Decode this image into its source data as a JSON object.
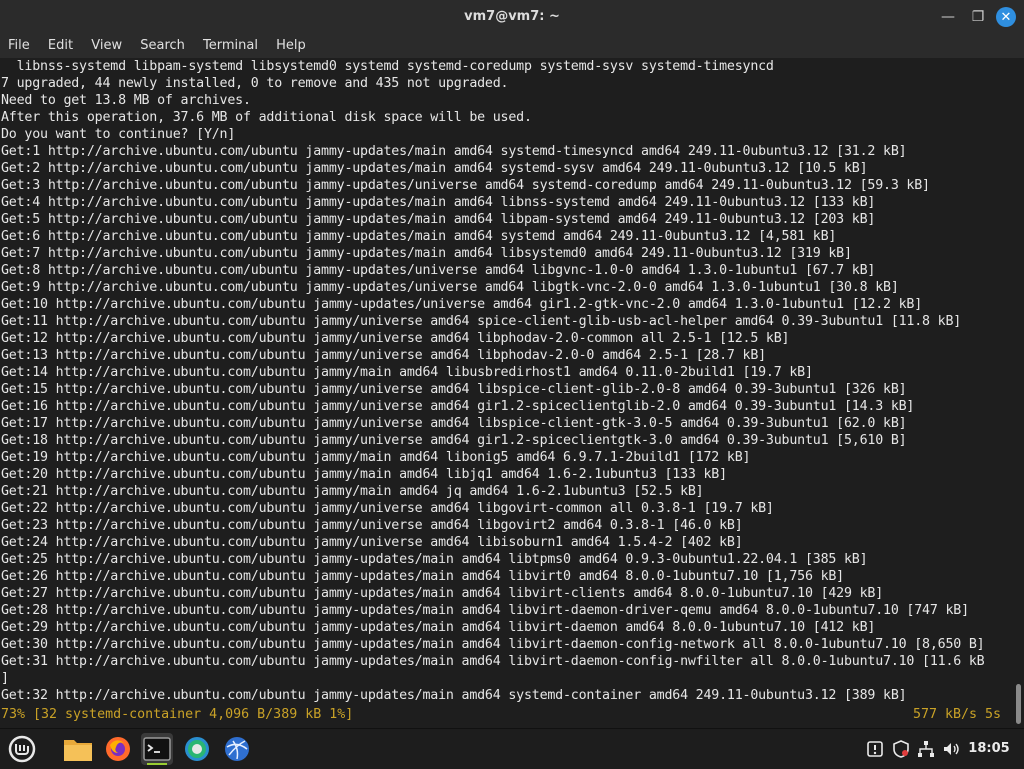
{
  "window": {
    "title": "vm7@vm7: ~"
  },
  "menu": [
    "File",
    "Edit",
    "View",
    "Search",
    "Terminal",
    "Help"
  ],
  "terminal": {
    "lines": [
      "  libnss-systemd libpam-systemd libsystemd0 systemd systemd-coredump systemd-sysv systemd-timesyncd",
      "7 upgraded, 44 newly installed, 0 to remove and 435 not upgraded.",
      "Need to get 13.8 MB of archives.",
      "After this operation, 37.6 MB of additional disk space will be used.",
      "Do you want to continue? [Y/n]",
      "Get:1 http://archive.ubuntu.com/ubuntu jammy-updates/main amd64 systemd-timesyncd amd64 249.11-0ubuntu3.12 [31.2 kB]",
      "Get:2 http://archive.ubuntu.com/ubuntu jammy-updates/main amd64 systemd-sysv amd64 249.11-0ubuntu3.12 [10.5 kB]",
      "Get:3 http://archive.ubuntu.com/ubuntu jammy-updates/universe amd64 systemd-coredump amd64 249.11-0ubuntu3.12 [59.3 kB]",
      "Get:4 http://archive.ubuntu.com/ubuntu jammy-updates/main amd64 libnss-systemd amd64 249.11-0ubuntu3.12 [133 kB]",
      "Get:5 http://archive.ubuntu.com/ubuntu jammy-updates/main amd64 libpam-systemd amd64 249.11-0ubuntu3.12 [203 kB]",
      "Get:6 http://archive.ubuntu.com/ubuntu jammy-updates/main amd64 systemd amd64 249.11-0ubuntu3.12 [4,581 kB]",
      "Get:7 http://archive.ubuntu.com/ubuntu jammy-updates/main amd64 libsystemd0 amd64 249.11-0ubuntu3.12 [319 kB]",
      "Get:8 http://archive.ubuntu.com/ubuntu jammy-updates/universe amd64 libgvnc-1.0-0 amd64 1.3.0-1ubuntu1 [67.7 kB]",
      "Get:9 http://archive.ubuntu.com/ubuntu jammy-updates/universe amd64 libgtk-vnc-2.0-0 amd64 1.3.0-1ubuntu1 [30.8 kB]",
      "Get:10 http://archive.ubuntu.com/ubuntu jammy-updates/universe amd64 gir1.2-gtk-vnc-2.0 amd64 1.3.0-1ubuntu1 [12.2 kB]",
      "Get:11 http://archive.ubuntu.com/ubuntu jammy/universe amd64 spice-client-glib-usb-acl-helper amd64 0.39-3ubuntu1 [11.8 kB]",
      "Get:12 http://archive.ubuntu.com/ubuntu jammy/universe amd64 libphodav-2.0-common all 2.5-1 [12.5 kB]",
      "Get:13 http://archive.ubuntu.com/ubuntu jammy/universe amd64 libphodav-2.0-0 amd64 2.5-1 [28.7 kB]",
      "Get:14 http://archive.ubuntu.com/ubuntu jammy/main amd64 libusbredirhost1 amd64 0.11.0-2build1 [19.7 kB]",
      "Get:15 http://archive.ubuntu.com/ubuntu jammy/universe amd64 libspice-client-glib-2.0-8 amd64 0.39-3ubuntu1 [326 kB]",
      "Get:16 http://archive.ubuntu.com/ubuntu jammy/universe amd64 gir1.2-spiceclientglib-2.0 amd64 0.39-3ubuntu1 [14.3 kB]",
      "Get:17 http://archive.ubuntu.com/ubuntu jammy/universe amd64 libspice-client-gtk-3.0-5 amd64 0.39-3ubuntu1 [62.0 kB]",
      "Get:18 http://archive.ubuntu.com/ubuntu jammy/universe amd64 gir1.2-spiceclientgtk-3.0 amd64 0.39-3ubuntu1 [5,610 B]",
      "Get:19 http://archive.ubuntu.com/ubuntu jammy/main amd64 libonig5 amd64 6.9.7.1-2build1 [172 kB]",
      "Get:20 http://archive.ubuntu.com/ubuntu jammy/main amd64 libjq1 amd64 1.6-2.1ubuntu3 [133 kB]",
      "Get:21 http://archive.ubuntu.com/ubuntu jammy/main amd64 jq amd64 1.6-2.1ubuntu3 [52.5 kB]",
      "Get:22 http://archive.ubuntu.com/ubuntu jammy/universe amd64 libgovirt-common all 0.3.8-1 [19.7 kB]",
      "Get:23 http://archive.ubuntu.com/ubuntu jammy/universe amd64 libgovirt2 amd64 0.3.8-1 [46.0 kB]",
      "Get:24 http://archive.ubuntu.com/ubuntu jammy/universe amd64 libisoburn1 amd64 1.5.4-2 [402 kB]",
      "Get:25 http://archive.ubuntu.com/ubuntu jammy-updates/main amd64 libtpms0 amd64 0.9.3-0ubuntu1.22.04.1 [385 kB]",
      "Get:26 http://archive.ubuntu.com/ubuntu jammy-updates/main amd64 libvirt0 amd64 8.0.0-1ubuntu7.10 [1,756 kB]",
      "Get:27 http://archive.ubuntu.com/ubuntu jammy-updates/main amd64 libvirt-clients amd64 8.0.0-1ubuntu7.10 [429 kB]",
      "Get:28 http://archive.ubuntu.com/ubuntu jammy-updates/main amd64 libvirt-daemon-driver-qemu amd64 8.0.0-1ubuntu7.10 [747 kB]",
      "Get:29 http://archive.ubuntu.com/ubuntu jammy-updates/main amd64 libvirt-daemon amd64 8.0.0-1ubuntu7.10 [412 kB]",
      "Get:30 http://archive.ubuntu.com/ubuntu jammy-updates/main amd64 libvirt-daemon-config-network all 8.0.0-1ubuntu7.10 [8,650 B]",
      "Get:31 http://archive.ubuntu.com/ubuntu jammy-updates/main amd64 libvirt-daemon-config-nwfilter all 8.0.0-1ubuntu7.10 [11.6 kB",
      "]",
      "Get:32 http://archive.ubuntu.com/ubuntu jammy-updates/main amd64 systemd-container amd64 249.11-0ubuntu3.12 [389 kB]"
    ],
    "status_left": "73% [32 systemd-container 4,096 B/389 kB 1%]",
    "status_right": "577 kB/s 5s",
    "status_color": "#c9a227"
  },
  "taskbar": {
    "apps": [
      "mint-menu-icon",
      "files-icon",
      "firefox-icon",
      "terminal-icon",
      "browser-icon",
      "network-globe-icon"
    ],
    "tray": [
      "update-manager-icon",
      "shield-icon",
      "network-icon",
      "volume-icon"
    ],
    "clock": "18:05",
    "accent": "#9acd32"
  },
  "colors": {
    "titlebar": "#2b2b2b",
    "terminal_bg": "#1e1e1e",
    "close_button": "#2f8fe0"
  }
}
